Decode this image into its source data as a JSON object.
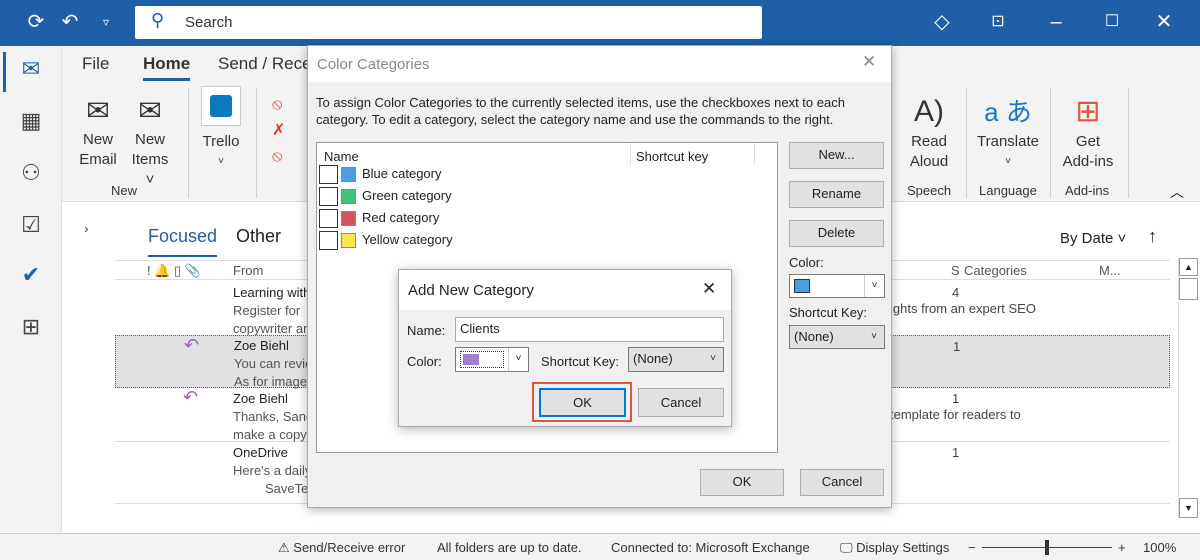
{
  "titlebar": {
    "search_placeholder": "Search"
  },
  "ribbon": {
    "tabs": [
      "File",
      "Home",
      "Send / Rece"
    ],
    "buttons": {
      "new_email": [
        "New",
        "Email"
      ],
      "new_items": [
        "New",
        "Items ˅"
      ],
      "trello": "Trello",
      "read_aloud": [
        "Read",
        "Aloud"
      ],
      "translate": "Translate",
      "get_addins": [
        "Get",
        "Add-ins"
      ]
    },
    "groups": {
      "new": "New",
      "speech": "Speech",
      "language": "Language",
      "addins": "Add-ins"
    }
  },
  "mail": {
    "tabs": [
      "Focused",
      "Other"
    ],
    "sort": "By Date",
    "columns": {
      "from": "From",
      "s": "S",
      "categories": "Categories",
      "m": "M..."
    },
    "rows": [
      {
        "from": "Learning with",
        "line2": "Register for",
        "line3": "copywriter ar",
        "count": "4",
        "preview": "ights from an expert SEO"
      },
      {
        "from": "Zoe Biehl",
        "line2": "You can revie",
        "line3": "As for image",
        "count": "1",
        "preview": ""
      },
      {
        "from": "Zoe Biehl",
        "line2": "Thanks, Sand",
        "line3": "make a copy",
        "count": "1",
        "preview": "template for readers to"
      },
      {
        "from": "OneDrive",
        "line2": "Here's a daily",
        "line3": "SaveTe:",
        "count": "1",
        "preview": ""
      }
    ]
  },
  "color_dialog": {
    "title": "Color Categories",
    "instructions": "To assign Color Categories to the currently selected items, use the checkboxes next to each category.  To edit a category, select the category name and use the commands to the right.",
    "headers": {
      "name": "Name",
      "shortcut": "Shortcut key"
    },
    "categories": [
      {
        "name": "Blue category",
        "color": "#4a9fe0"
      },
      {
        "name": "Green category",
        "color": "#43c07a"
      },
      {
        "name": "Red category",
        "color": "#d9505f"
      },
      {
        "name": "Yellow category",
        "color": "#fbe64f"
      }
    ],
    "buttons": {
      "new": "New...",
      "rename": "Rename",
      "delete": "Delete",
      "ok": "OK",
      "cancel": "Cancel"
    },
    "color_label": "Color:",
    "color_value": "#4a9fe0",
    "shortcut_label": "Shortcut Key:",
    "shortcut_value": "(None)"
  },
  "add_dialog": {
    "title": "Add New Category",
    "name_label": "Name:",
    "name_value": "Clients",
    "color_label": "Color:",
    "color_value": "#a17fcf",
    "shortcut_label": "Shortcut Key:",
    "shortcut_value": "(None)",
    "ok": "OK",
    "cancel": "Cancel"
  },
  "statusbar": {
    "error": "Send/Receive error",
    "folders": "All folders are up to date.",
    "connected": "Connected to: Microsoft Exchange",
    "display": "Display Settings",
    "zoom": "100%",
    "zoom_level": 100
  }
}
